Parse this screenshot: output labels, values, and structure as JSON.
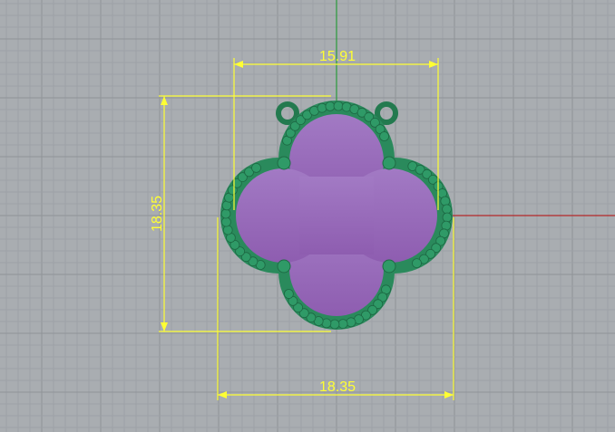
{
  "viewport": {
    "grid": true,
    "colors": {
      "background": "#a9adb1",
      "grid_minor": "#9da1a6",
      "grid_major": "#8f9398",
      "axis_x": "#b4282a",
      "axis_y": "#2a9a3a",
      "dimension": "#ffff33",
      "part_body": "#9b6dbb",
      "part_rim": "#2a8a5c"
    },
    "model": {
      "name": "quatrefoil-pendant",
      "bail_count": 2,
      "bead_count": 4
    },
    "dimensions": {
      "top_width": "15.91",
      "left_height": "18.35",
      "bottom_width": "18.35"
    }
  }
}
